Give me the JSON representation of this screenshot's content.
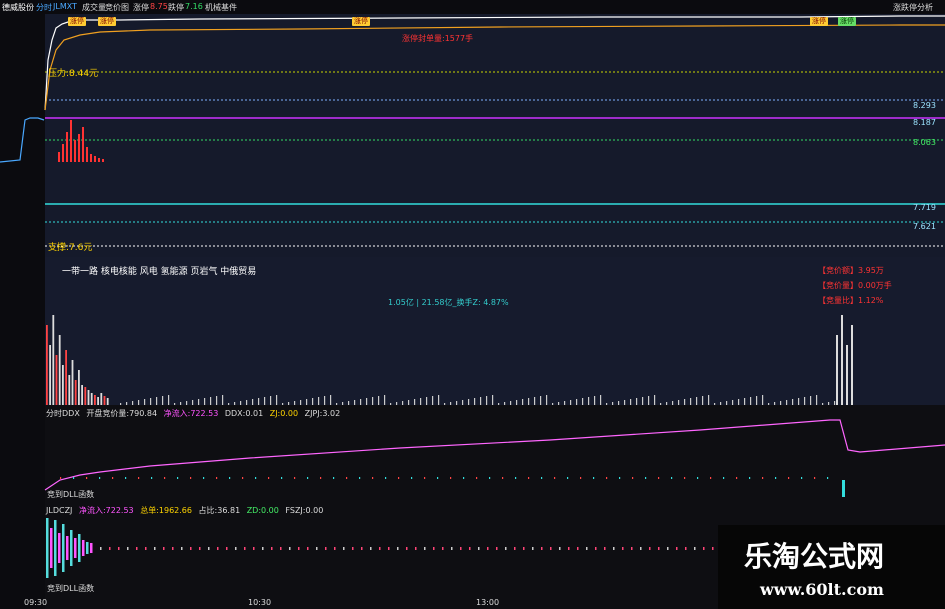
{
  "topbar": {
    "stock_name": "德威股份",
    "tab_label": "分时",
    "indicator_label": "JLMXT",
    "item_volume": "成交量",
    "item_price_image": "竞价图",
    "limit_up_label": "涨停",
    "limit_up_value": "8.75",
    "limit_down_label": "跌停",
    "limit_down_value": "7.16",
    "sector_label": "机械基件",
    "right_link": "涨跌停分析"
  },
  "tags": {
    "tag1": "涨停",
    "tag2": "涨停",
    "tag3": "涨停",
    "tag4": "涨停",
    "tag5": "涨停",
    "red_note": "涨停封单量:1577手"
  },
  "levels": {
    "pressure": "压力:8.44元",
    "support": "支撑:7.6元",
    "price1": "8.293",
    "price2": "8.187",
    "price3": "8.063",
    "price4": "7.719",
    "price5": "7.621"
  },
  "concept_text": "一带一路 核电核能 风电 氢能源 页岩气 中俄贸易",
  "info_boxes": {
    "box1": "【竞价额】3.95万",
    "box2": "【竞价量】0.00万手",
    "box3": "【竞量比】1.12%"
  },
  "volume_info": "1.05亿 | 21.58亿_换手Z: 4.87%",
  "ddx": {
    "title": "分时DDX",
    "open_label": "开盘竞价量:",
    "open_value": "790.84",
    "netin_label": "净流入:",
    "netin_value": "722.53",
    "ddx_label": "DDX:",
    "ddx_value": "0.01",
    "zj_label": "ZJ:",
    "zj_value": "0.00",
    "zjpj_label": "ZJPJ:",
    "zjpj_value": "3.02",
    "bottom_label": "竞到DLL函数"
  },
  "jldczj": {
    "title": "JLDCZJ",
    "netin_label": "净流入:",
    "netin_value": "722.53",
    "total_label": "总单:",
    "total_value": "1962.66",
    "ratio_label": "占比:",
    "ratio_value": "36.81",
    "zd_label": "ZD:",
    "zd_value": "0.00",
    "fszj_label": "FSZJ:",
    "fszj_value": "0.00",
    "bottom_label": "竞到DLL函数"
  },
  "time_axis": [
    "09:30",
    "10:30",
    "13:00"
  ],
  "watermark": {
    "title": "乐淘公式网",
    "url": "www.60lt.com"
  },
  "chart_data": {
    "type": "line",
    "x": [
      "09:30",
      "10:30",
      "13:00",
      "15:00"
    ],
    "series": [],
    "ylim": [
      7.5,
      8.8
    ]
  }
}
